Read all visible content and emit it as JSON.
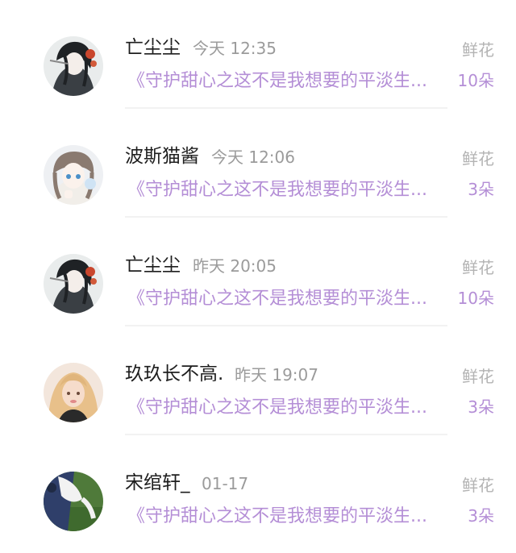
{
  "rows": [
    {
      "name": "亡尘尘",
      "time": "今天 12:35",
      "work": "《守护甜心之这不是我想要的平淡生活》",
      "gift_label": "鲜花",
      "gift_count": "10朵",
      "avatar_icon": "avatar-ink-boy-icon"
    },
    {
      "name": "波斯猫酱",
      "time": "今天 12:06",
      "work": "《守护甜心之这不是我想要的平淡生活》",
      "gift_label": "鲜花",
      "gift_count": "3朵",
      "avatar_icon": "avatar-anime-girl-icon"
    },
    {
      "name": "亡尘尘",
      "time": "昨天 20:05",
      "work": "《守护甜心之这不是我想要的平淡生活》",
      "gift_label": "鲜花",
      "gift_count": "10朵",
      "avatar_icon": "avatar-ink-boy-icon"
    },
    {
      "name": "玖玖长不高.",
      "time": "昨天 19:07",
      "work": "《守护甜心之这不是我想要的平淡生活》",
      "gift_label": "鲜花",
      "gift_count": "3朵",
      "avatar_icon": "avatar-blonde-girl-icon"
    },
    {
      "name": "宋绾轩_",
      "time": "01-17",
      "work": "《守护甜心之这不是我想要的平淡生活》",
      "gift_label": "鲜花",
      "gift_count": "3朵",
      "avatar_icon": "avatar-sports-icon"
    }
  ]
}
